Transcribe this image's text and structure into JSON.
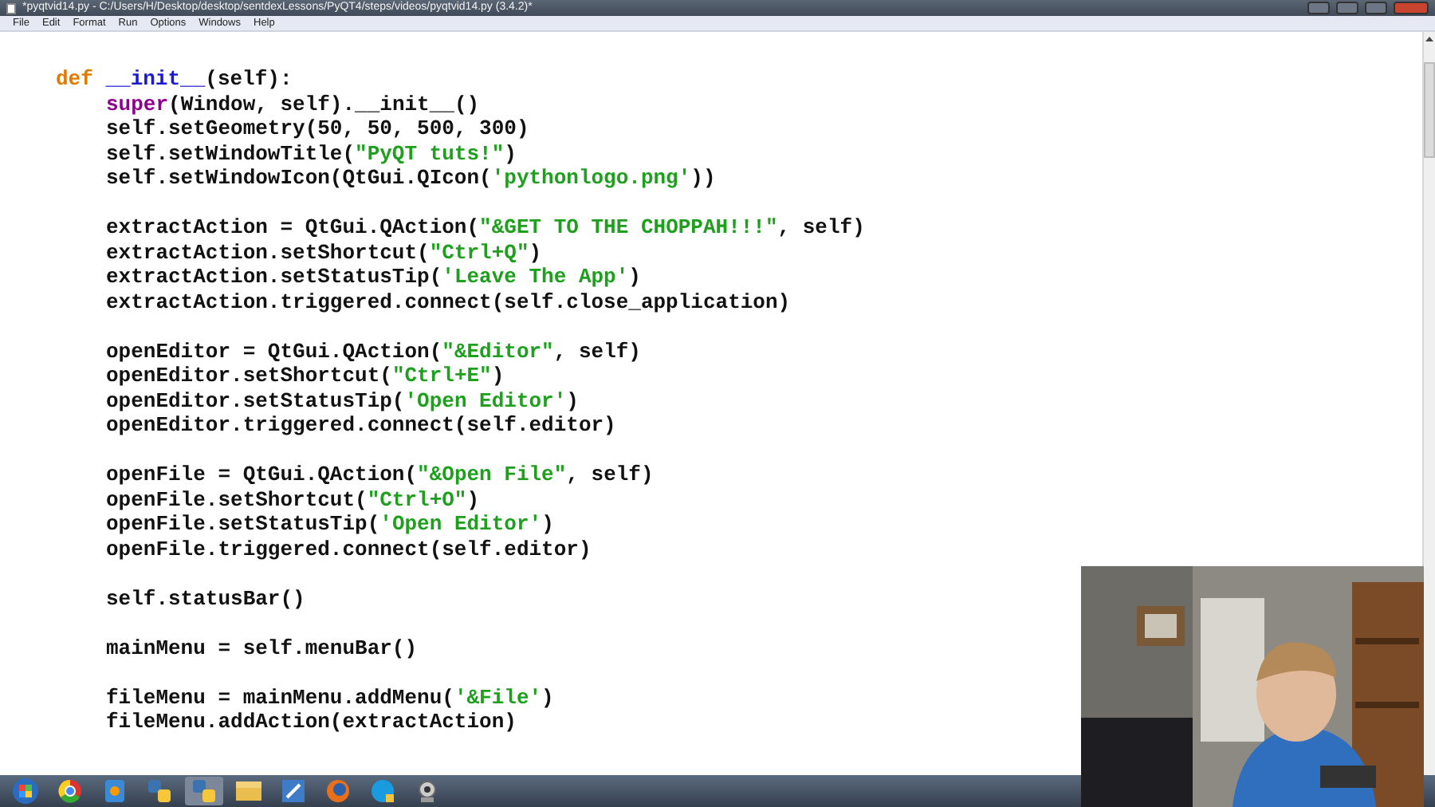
{
  "window": {
    "title": "*pyqtvid14.py - C:/Users/H/Desktop/desktop/sentdexLessons/PyQT4/steps/videos/pyqtvid14.py (3.4.2)*"
  },
  "menu": [
    "File",
    "Edit",
    "Format",
    "Run",
    "Options",
    "Windows",
    "Help"
  ],
  "code": [
    {
      "tokens": [
        {
          "kind": "keyword",
          "text": "def "
        },
        {
          "kind": "name",
          "text": "__init__"
        },
        {
          "kind": "plain",
          "text": "(self):"
        }
      ],
      "children": [
        {
          "tokens": [
            {
              "kind": "builtin",
              "text": "super"
            },
            {
              "kind": "plain",
              "text": "(Window, self).__init__()"
            }
          ]
        },
        {
          "tokens": [
            {
              "kind": "plain",
              "text": "self.setGeometry(50, 50, 500, 300)"
            }
          ]
        },
        {
          "tokens": [
            {
              "kind": "plain",
              "text": "self.setWindowTitle("
            },
            {
              "kind": "string",
              "text": "\"PyQT tuts!\""
            },
            {
              "kind": "plain",
              "text": ")"
            }
          ]
        },
        {
          "tokens": [
            {
              "kind": "plain",
              "text": "self.setWindowIcon(QtGui.QIcon("
            },
            {
              "kind": "string",
              "text": "'pythonlogo.png'"
            },
            {
              "kind": "plain",
              "text": "))"
            }
          ]
        },
        {
          "kind": "blank"
        },
        {
          "tokens": [
            {
              "kind": "plain",
              "text": "extractAction = QtGui.QAction("
            },
            {
              "kind": "string",
              "text": "\"&GET TO THE CHOPPAH!!!\""
            },
            {
              "kind": "plain",
              "text": ", self)"
            }
          ]
        },
        {
          "tokens": [
            {
              "kind": "plain",
              "text": "extractAction.setShortcut("
            },
            {
              "kind": "string",
              "text": "\"Ctrl+Q\""
            },
            {
              "kind": "plain",
              "text": ")"
            }
          ]
        },
        {
          "tokens": [
            {
              "kind": "plain",
              "text": "extractAction.setStatusTip("
            },
            {
              "kind": "string",
              "text": "'Leave The App'"
            },
            {
              "kind": "plain",
              "text": ")"
            }
          ]
        },
        {
          "tokens": [
            {
              "kind": "plain",
              "text": "extractAction.triggered.connect(self.close_application)"
            }
          ]
        },
        {
          "kind": "blank"
        },
        {
          "tokens": [
            {
              "kind": "plain",
              "text": "openEditor = QtGui.QAction("
            },
            {
              "kind": "string",
              "text": "\"&Editor\""
            },
            {
              "kind": "plain",
              "text": ", self)"
            }
          ]
        },
        {
          "tokens": [
            {
              "kind": "plain",
              "text": "openEditor.setShortcut("
            },
            {
              "kind": "string",
              "text": "\"Ctrl+E\""
            },
            {
              "kind": "plain",
              "text": ")"
            }
          ]
        },
        {
          "tokens": [
            {
              "kind": "plain",
              "text": "openEditor.setStatusTip("
            },
            {
              "kind": "string",
              "text": "'Open Editor'"
            },
            {
              "kind": "plain",
              "text": ")"
            }
          ]
        },
        {
          "tokens": [
            {
              "kind": "plain",
              "text": "openEditor.triggered.connect(self.editor)"
            }
          ]
        },
        {
          "kind": "blank"
        },
        {
          "tokens": [
            {
              "kind": "plain",
              "text": "openFile = QtGui.QAction("
            },
            {
              "kind": "string",
              "text": "\"&Open File\""
            },
            {
              "kind": "plain",
              "text": ", self)"
            }
          ]
        },
        {
          "tokens": [
            {
              "kind": "plain",
              "text": "openFile.setShortcut("
            },
            {
              "kind": "string",
              "text": "\"Ctrl+O\""
            },
            {
              "kind": "plain",
              "text": ")"
            }
          ]
        },
        {
          "tokens": [
            {
              "kind": "plain",
              "text": "openFile.setStatusTip("
            },
            {
              "kind": "string",
              "text": "'Open Editor'"
            },
            {
              "kind": "plain",
              "text": ")"
            }
          ]
        },
        {
          "tokens": [
            {
              "kind": "plain",
              "text": "openFile.triggered.connect(self.editor)"
            }
          ]
        },
        {
          "kind": "blank"
        },
        {
          "tokens": [
            {
              "kind": "plain",
              "text": "self.statusBar()"
            }
          ]
        },
        {
          "kind": "blank"
        },
        {
          "tokens": [
            {
              "kind": "plain",
              "text": "mainMenu = self.menuBar()"
            }
          ]
        },
        {
          "kind": "blank"
        },
        {
          "tokens": [
            {
              "kind": "plain",
              "text": "fileMenu = mainMenu.addMenu("
            },
            {
              "kind": "string",
              "text": "'&File'"
            },
            {
              "kind": "plain",
              "text": ")"
            }
          ]
        },
        {
          "tokens": [
            {
              "kind": "plain",
              "text": "fileMenu.addAction(extractAction)"
            }
          ]
        }
      ]
    }
  ]
}
